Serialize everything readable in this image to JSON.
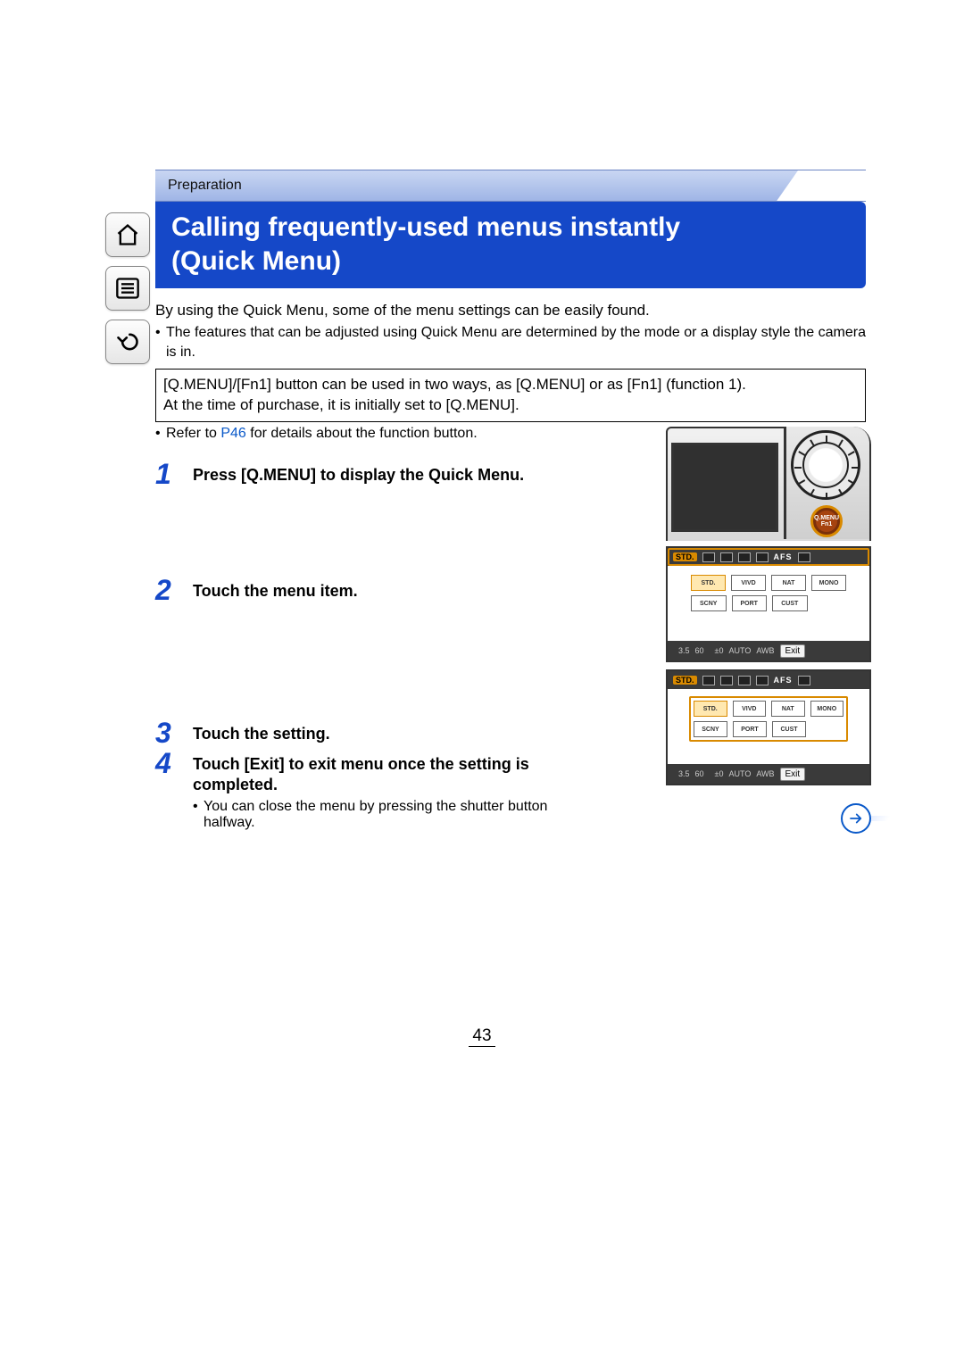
{
  "breadcrumb": "Preparation",
  "title_line1": "Calling frequently-used menus instantly",
  "title_line2": "(Quick Menu)",
  "intro": "By using the Quick Menu, some of the menu settings can be easily found.",
  "intro_bullet": "The features that can be adjusted using Quick Menu are determined by the mode or a display style the camera is in.",
  "box_line1": "[Q.MENU]/[Fn1] button can be used in two ways, as [Q.MENU] or as [Fn1] (function 1).",
  "box_line2": "At the time of purchase, it is initially set to [Q.MENU].",
  "ref_prefix": "Refer to ",
  "ref_link": "P46",
  "ref_suffix": " for details about the function button.",
  "steps": [
    {
      "n": "1",
      "text": "Press [Q.MENU] to display the Quick Menu."
    },
    {
      "n": "2",
      "text": "Touch the menu item."
    },
    {
      "n": "3",
      "text": "Touch the setting."
    },
    {
      "n": "4",
      "text": "Touch [Exit] to exit menu once the setting is completed.",
      "sub": "You can close the menu by pressing the shutter button halfway."
    }
  ],
  "camera": {
    "button_top": "Q.MENU",
    "button_bot": "Fn1"
  },
  "lcd": {
    "top_chip": "STD.",
    "afs": "AFS",
    "opts_row1": [
      "STD.",
      "VIVD",
      "NAT",
      "MONO"
    ],
    "opts_row2": [
      "SCNY",
      "PORT",
      "CUST"
    ],
    "bot_aperture": "3.5",
    "bot_shutter": "60",
    "bot_ev": "±0",
    "bot_iso": "AUTO",
    "bot_awb": "AWB",
    "exit": "Exit"
  },
  "page_number": "43"
}
